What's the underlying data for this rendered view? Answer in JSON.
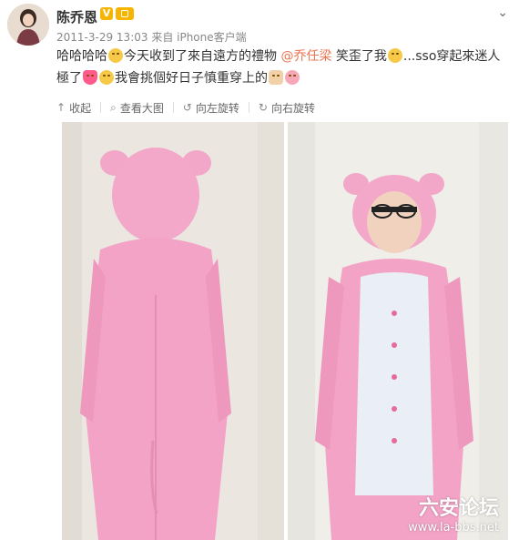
{
  "post": {
    "username": "陈乔恩",
    "vip_badge": "V",
    "meta": "2011-3-29 13:03 来自 iPhone客户端",
    "text_part1": "哈哈哈哈",
    "text_part2": "今天收到了來自遠方的禮物 ",
    "mention": "@乔任梁",
    "text_part3": " 笑歪了我",
    "text_part4": "...sso穿起來迷人極了",
    "text_part5": "我會挑個好日子慎重穿上的"
  },
  "toolbar": {
    "collect": "收起",
    "view_large": "查看大图",
    "rotate_left": "向左旋转",
    "rotate_right": "向右旋转"
  },
  "watermark": {
    "title": "六安论坛",
    "url": "www.la-bbs.net"
  },
  "icons": {
    "more": "chevron-down-icon",
    "collect": "arrow-up-icon",
    "view_large": "magnifier-icon",
    "rotate_left": "rotate-left-icon",
    "rotate_right": "rotate-right-icon"
  },
  "colors": {
    "mention": "#eb7350",
    "pig_pink": "#f3a3c6",
    "badge": "#f4b400"
  }
}
